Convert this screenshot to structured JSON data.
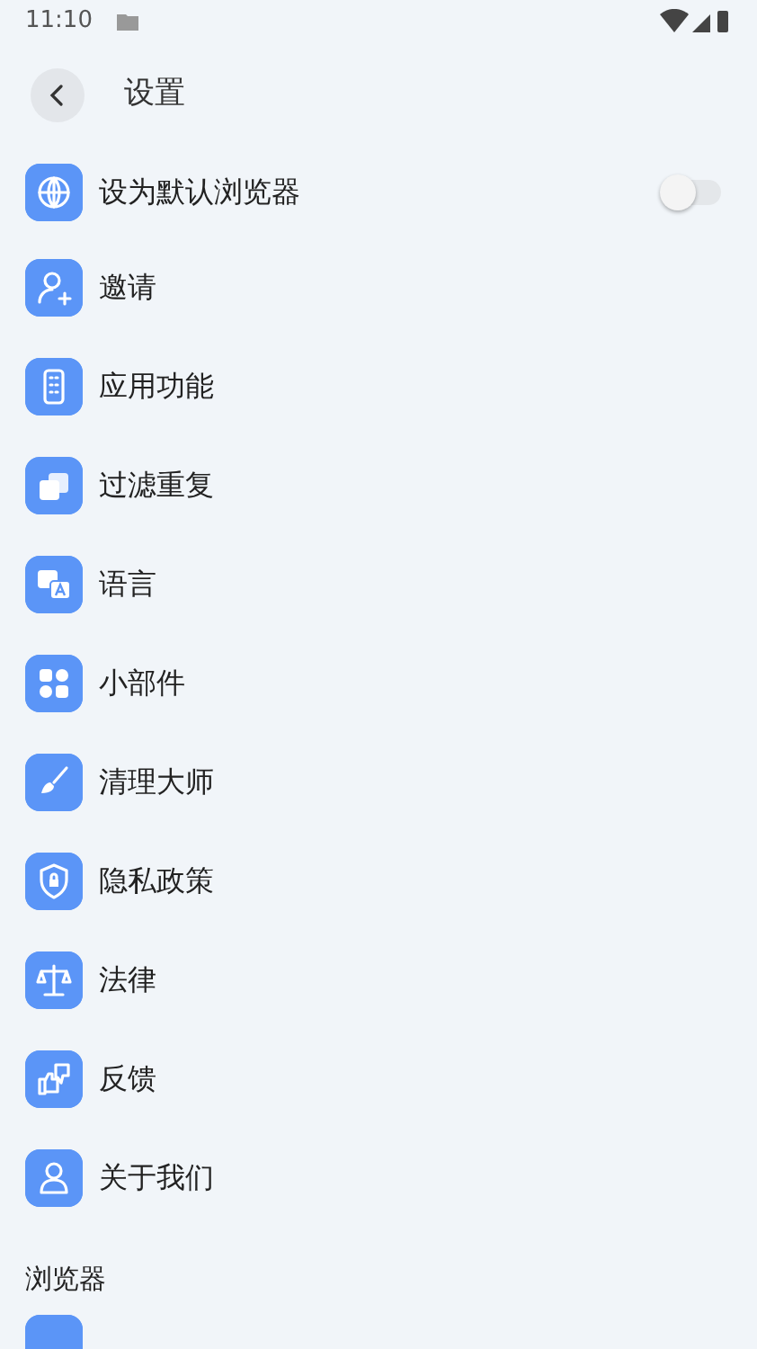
{
  "status_bar": {
    "time": "11:10"
  },
  "header": {
    "title": "设置"
  },
  "items": [
    {
      "kind": "toggle",
      "label": "设为默认浏览器",
      "on": false
    },
    {
      "kind": "link",
      "label": "邀请"
    },
    {
      "kind": "link",
      "label": "应用功能"
    },
    {
      "kind": "link",
      "label": "过滤重复"
    },
    {
      "kind": "link",
      "label": "语言"
    },
    {
      "kind": "link",
      "label": "小部件"
    },
    {
      "kind": "link",
      "label": "清理大师"
    },
    {
      "kind": "link",
      "label": "隐私政策"
    },
    {
      "kind": "link",
      "label": "法律"
    },
    {
      "kind": "link",
      "label": "反馈"
    },
    {
      "kind": "link",
      "label": "关于我们"
    }
  ],
  "section": {
    "title": "浏览器"
  }
}
